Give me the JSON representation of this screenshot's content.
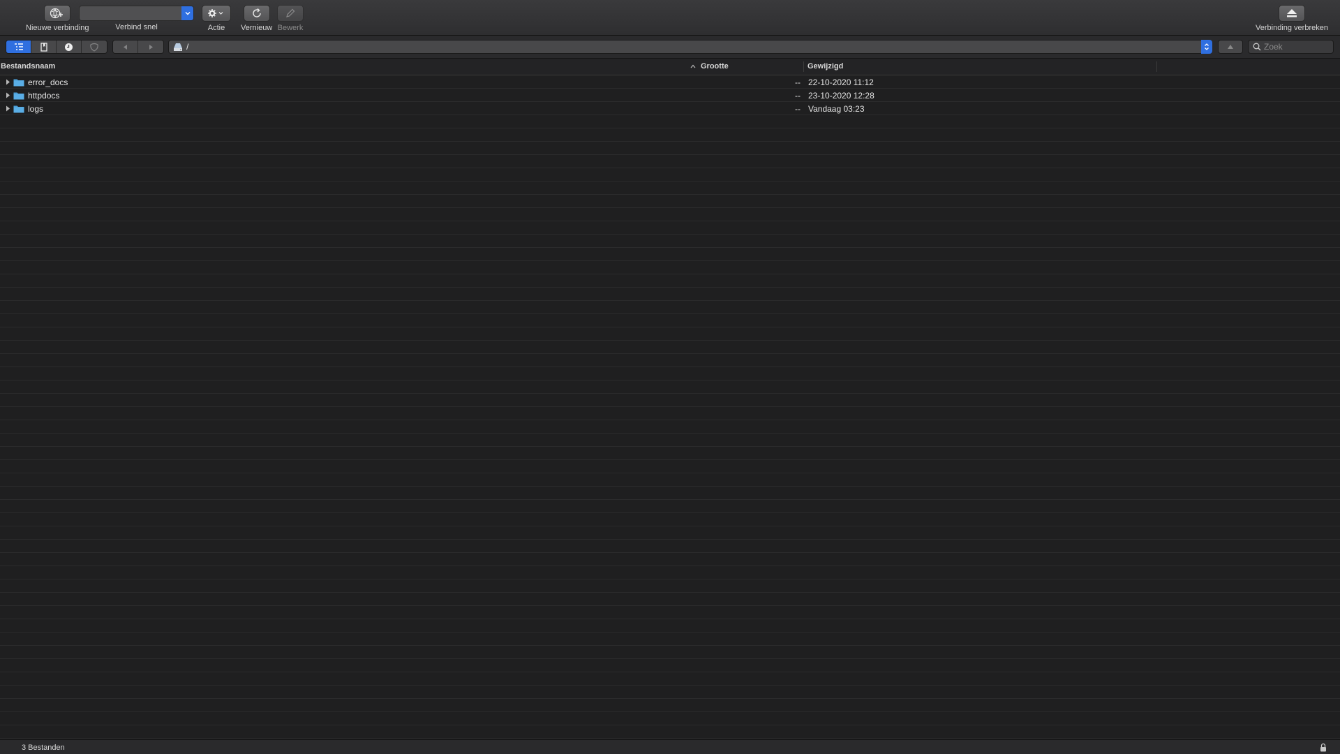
{
  "toolbar": {
    "new_connection": "Nieuwe verbinding",
    "quick_connect": "Verbind snel",
    "action": "Actie",
    "refresh": "Vernieuw",
    "edit": "Bewerk",
    "disconnect": "Verbinding verbreken"
  },
  "nav": {
    "path": "/",
    "search_placeholder": "Zoek"
  },
  "columns": {
    "filename": "Bestandsnaam",
    "size": "Grootte",
    "modified": "Gewijzigd"
  },
  "files": [
    {
      "name": "error_docs",
      "size": "--",
      "modified": "22-10-2020 11:12"
    },
    {
      "name": "httpdocs",
      "size": "--",
      "modified": "23-10-2020 12:28"
    },
    {
      "name": "logs",
      "size": "--",
      "modified": "Vandaag 03:23"
    }
  ],
  "status": {
    "count": "3 Bestanden"
  },
  "colors": {
    "accent": "#2f6fe0",
    "folder": "#5aaee6"
  }
}
